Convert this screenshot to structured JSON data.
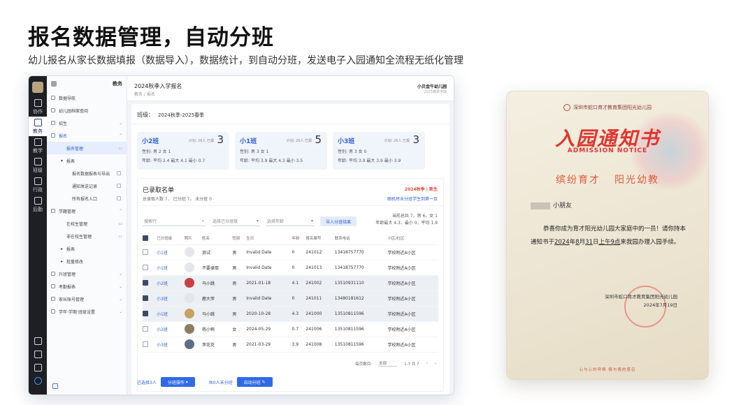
{
  "hero": {
    "title": "报名数据管理，自动分班",
    "subtitle": "幼儿报名从家长数据填报（数据导入），数据统计，到自动分班，发送电子入园通知全流程无纸化管理"
  },
  "rail": {
    "items": [
      {
        "label": "协作",
        "icon": "collaboration-icon"
      },
      {
        "label": "教务",
        "icon": "academic-icon"
      },
      {
        "label": "教学",
        "icon": "teaching-icon"
      },
      {
        "label": "班级",
        "icon": "class-icon"
      },
      {
        "label": "行政",
        "icon": "admin-icon"
      },
      {
        "label": "后勤",
        "icon": "logistics-icon"
      }
    ]
  },
  "sidebar": {
    "title": "教务",
    "items": [
      {
        "label": "数据导航"
      },
      {
        "label": "幼儿园档案查阅"
      },
      {
        "label": "招生"
      },
      {
        "label": "报名"
      },
      {
        "label": "报名管理"
      },
      {
        "label": "报表"
      },
      {
        "label": "报名数据报表与导出"
      },
      {
        "label": "通知发送记录"
      },
      {
        "label": "所有报名入口"
      },
      {
        "label": "学籍管理"
      },
      {
        "label": "在校生管理"
      },
      {
        "label": "非在校生管理"
      },
      {
        "label": "报表"
      },
      {
        "label": "批量修改"
      },
      {
        "label": "升班管理"
      },
      {
        "label": "考勤报表"
      },
      {
        "label": "家长账号管理"
      },
      {
        "label": "学年·学期·班级设置"
      }
    ]
  },
  "topbar": {
    "title": "2024秋季入学报名",
    "breadcrumb": "教务 / 报名",
    "school": "小贝金牛幼儿园",
    "school_sub": "2025春季学期"
  },
  "term": {
    "label": "班级：",
    "value": "2024秋季-2025春季"
  },
  "cards": [
    {
      "name": "小2班",
      "plan": "计划: 26人  已报",
      "count": "3",
      "gender_label": "性别:",
      "male": "男 2",
      "female": "女 1",
      "age_label": "年龄:",
      "avg": "平均 2.4",
      "max": "最大 4.1",
      "min": "最小 0.7"
    },
    {
      "name": "小1班",
      "plan": "计划: 26人  已报",
      "count": "5",
      "gender_label": "性别:",
      "male": "男 3",
      "female": "女 1",
      "age_label": "年龄:",
      "avg": "平均 3.9",
      "max": "最大 4.3",
      "min": "最小 3.5"
    },
    {
      "name": "小3班",
      "plan": "计划: 26人  已报",
      "count": "3",
      "gender_label": "性别:",
      "male": "男 3",
      "female": "女 0",
      "age_label": "年龄:",
      "avg": "平均 3.9",
      "max": "最大 3.9",
      "min": "最小 3.9"
    }
  ],
  "list": {
    "title": "已录取名单",
    "tag": "2024秋季 | 新生",
    "stats": "总录取人数 7，  已分班 7，  未分班 0",
    "link": "随机将未分班学生到第一页",
    "search_placeholder": "搜索行",
    "class_filter": "选择已分班级",
    "age_filter": "选择年龄",
    "import_button": "导入分班结果",
    "ratio_line1": "当前总共 7，男 6，女 1",
    "ratio_line2": "年龄最大 4.3，最小 0，平均 1.9",
    "columns": [
      "已分班级",
      "照片",
      "姓名",
      "性别",
      "生日",
      "年龄",
      "报名编号",
      "联系电话",
      "小区/社区"
    ],
    "rows": [
      {
        "checked": false,
        "cls": "小1班",
        "photo": "",
        "name": "测试",
        "gender": "男",
        "birth": "Invalid Date",
        "age": "0",
        "no": "241012",
        "phone": "13418757770",
        "area": "学校附近A小区"
      },
      {
        "checked": false,
        "cls": "小1班",
        "photo": "",
        "name": "不要录取",
        "gender": "男",
        "birth": "Invalid Date",
        "age": "0",
        "no": "241013",
        "phone": "13418757770",
        "area": "学校附近A小区"
      },
      {
        "checked": true,
        "cls": "小2班",
        "photo": "p1",
        "name": "马小跳",
        "gender": "男",
        "birth": "2021-01-18",
        "age": "4.1",
        "no": "241002",
        "phone": "13510931110",
        "area": "学校附近A小区"
      },
      {
        "checked": true,
        "cls": "小3班",
        "photo": "",
        "name": "鹿大萍",
        "gender": "男",
        "birth": "Invalid Date",
        "age": "0",
        "no": "241011",
        "phone": "13480181612",
        "area": "学校附近A小区"
      },
      {
        "checked": true,
        "cls": "小1班",
        "photo": "p2",
        "name": "马小跳",
        "gender": "男",
        "birth": "2020-10-28",
        "age": "4.3",
        "no": "241000",
        "phone": "13510811596",
        "area": "学校附近A小区"
      },
      {
        "checked": false,
        "cls": "小2班",
        "photo": "p3",
        "name": "杨小鸭",
        "gender": "女",
        "birth": "2024-05-29",
        "age": "0.7",
        "no": "241006",
        "phone": "13510811596",
        "area": "学校附近A小区"
      },
      {
        "checked": false,
        "cls": "小3班",
        "photo": "p4",
        "name": "李花花",
        "gender": "男",
        "birth": "2021-03-29",
        "age": "3.9",
        "no": "241008",
        "phone": "13510811596",
        "area": "学校附近A小区"
      }
    ],
    "pager_label": "每页数目:",
    "pager_select": "全部",
    "pager_range": "1-7 共 7"
  },
  "footer": {
    "selected": "已选择3人",
    "assign_button": "分班操作",
    "unassigned": "共0人未分班",
    "auto_button": "自动分班"
  },
  "notice": {
    "school": "深圳市蛇口育才教育集团阳光幼儿园",
    "title": "入园通知书",
    "en_title": "ADMISSION NOTICE",
    "slogan_left": "缤纷育才",
    "slogan_right": "阳光幼教",
    "greeting": "小朋友",
    "body_pre": "恭喜你成为育才阳光幼儿园大家庭中的一员！请你持本通知书于",
    "year": "2024",
    "y_unit": "年",
    "month": "8",
    "m_unit": "月",
    "day": "31",
    "d_unit": "日",
    "time": "上午9点",
    "body_post": "来我园办理入园手续。",
    "sign_school": "深圳市蛇口育才教育集团阳光幼儿园",
    "sign_date": "2024年7月19日",
    "bottom": "心与心的呼唤 情与情的感召"
  },
  "colors": {
    "accent": "#2f6be8",
    "notice_red": "#e0352f",
    "tag_red": "#e04a3b",
    "rail_dark": "#1d1f24"
  }
}
